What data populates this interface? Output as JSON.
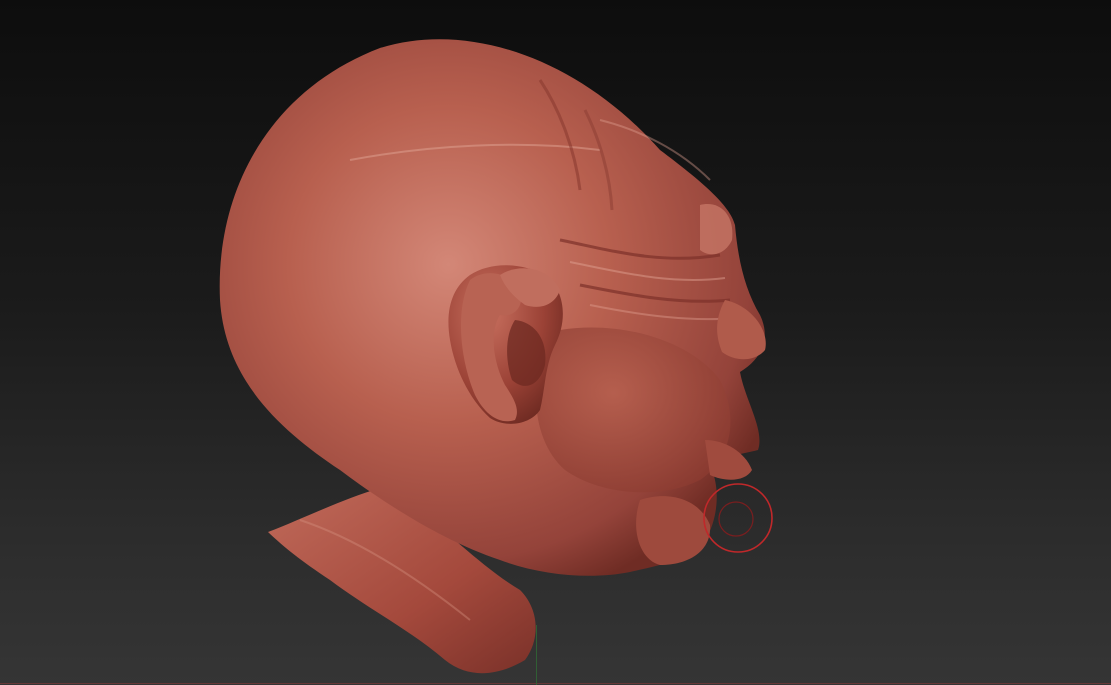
{
  "viewport": {
    "background_top": "#0d0d0d",
    "background_bottom": "#353535"
  },
  "model": {
    "material_color": "#b25a4c",
    "highlight_color": "#d98a7c",
    "shadow_color": "#6e2b22"
  },
  "brush_cursor": {
    "color": "#c0282a"
  }
}
